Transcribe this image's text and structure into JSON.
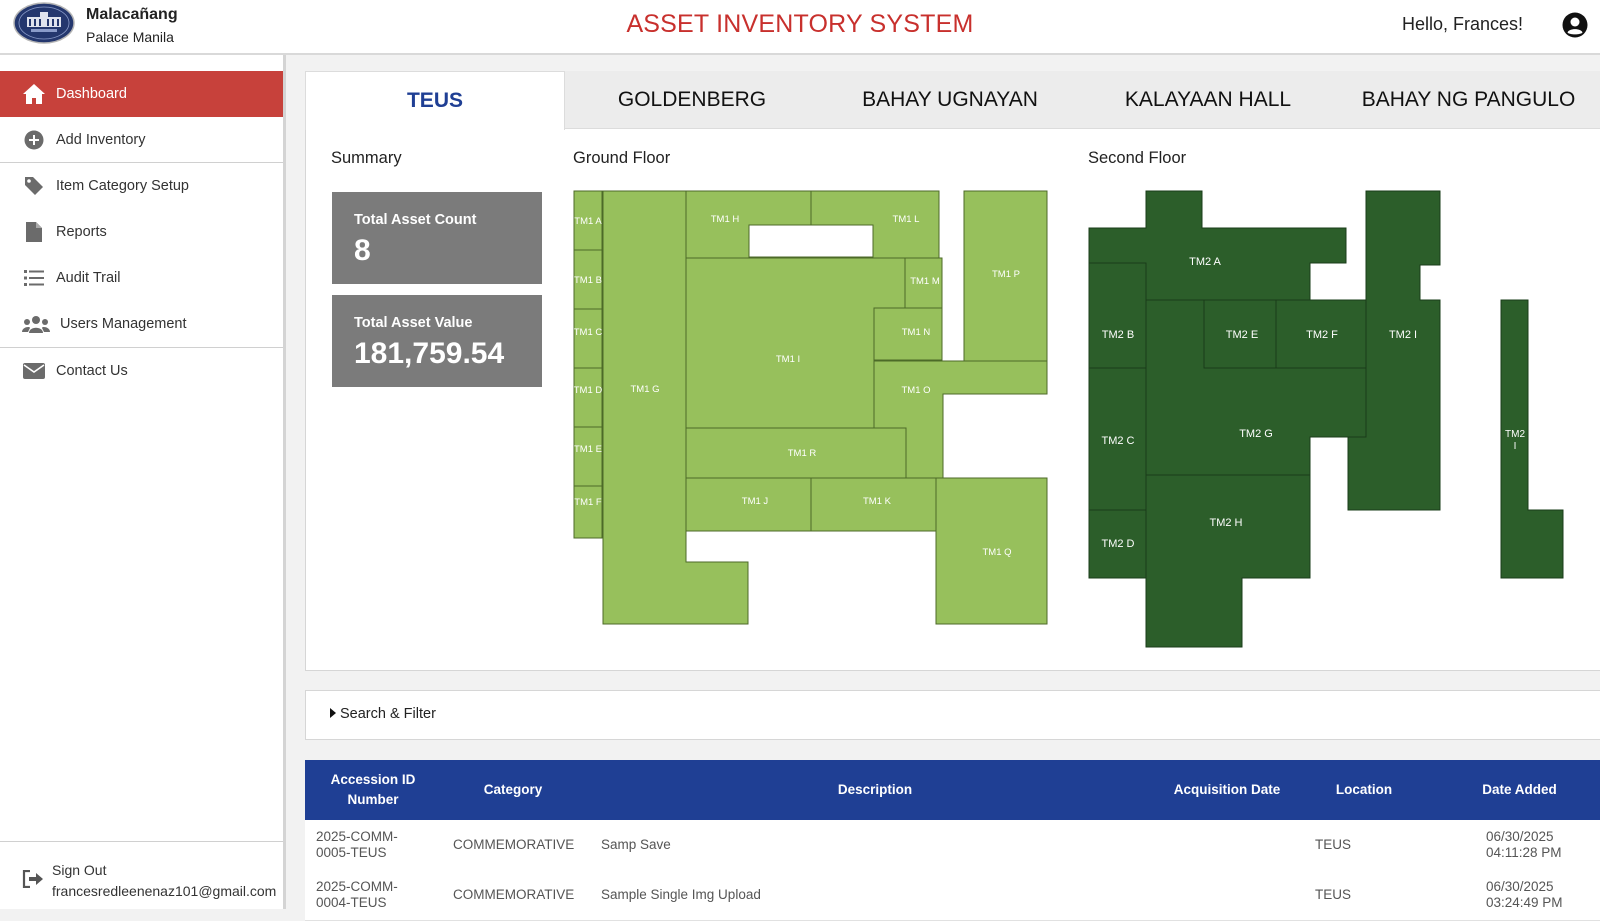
{
  "header": {
    "brand_line1": "Malacañang",
    "brand_line2": "Palace Manila",
    "app_title": "ASSET INVENTORY SYSTEM",
    "greeting": "Hello, Frances!"
  },
  "sidebar": {
    "items": [
      {
        "label": "Dashboard",
        "icon": "home-icon",
        "active": true
      },
      {
        "label": "Add Inventory",
        "icon": "plus-circle-icon"
      },
      {
        "label": "Item Category Setup",
        "icon": "tag-icon"
      },
      {
        "label": "Reports",
        "icon": "file-icon"
      },
      {
        "label": "Audit Trail",
        "icon": "list-icon"
      },
      {
        "label": "Users Management",
        "icon": "users-icon"
      },
      {
        "label": "Contact Us",
        "icon": "envelope-icon"
      }
    ],
    "signout_label": "Sign Out",
    "email": "francesredleenenaz101@gmail.com"
  },
  "tabs": [
    "TEUS",
    "GOLDENBERG",
    "BAHAY UGNAYAN",
    "KALAYAAN HALL",
    "BAHAY NG PANGULO"
  ],
  "summary": {
    "title": "Summary",
    "count_label": "Total Asset Count",
    "count_value": "8",
    "value_label": "Total Asset Value",
    "value_value": "181,759.54"
  },
  "floors": {
    "ground_title": "Ground Floor",
    "second_title": "Second Floor",
    "ground_color": "#97c05c",
    "second_color": "#2c5e2a",
    "ground_rooms": [
      "TM1 A",
      "TM1 B",
      "TM1 C",
      "TM1 D",
      "TM1 E",
      "TM1 F",
      "TM1 G",
      "TM1 H",
      "TM1 L",
      "TM1 P",
      "TM1 M",
      "TM1 I",
      "TM1 N",
      "TM1 O",
      "TM1 R",
      "TM1 J",
      "TM1 K",
      "TM1 Q"
    ],
    "second_rooms": [
      "TM2 A",
      "TM2 B",
      "TM2 E",
      "TM2 F",
      "TM2 I",
      "TM2 C",
      "TM2 G",
      "TM2 D",
      "TM2 H",
      "TM2 I"
    ]
  },
  "filter_label": "Search & Filter",
  "table": {
    "headers": [
      "Accession ID Number",
      "Category",
      "Description",
      "Acquisition Date",
      "Location",
      "Date Added"
    ],
    "rows": [
      {
        "id_line1": "2025-COMM-",
        "id_line2": "0005-TEUS",
        "category": "COMMEMORATIVE",
        "description": "Samp Save",
        "acq_date": "",
        "location": "TEUS",
        "added_line1": "06/30/2025",
        "added_line2": "04:11:28 PM"
      },
      {
        "id_line1": "2025-COMM-",
        "id_line2": "0004-TEUS",
        "category": "COMMEMORATIVE",
        "description": "Sample Single Img Upload",
        "acq_date": "",
        "location": "TEUS",
        "added_line1": "06/30/2025",
        "added_line2": "03:24:49 PM"
      }
    ]
  },
  "colors": {
    "accent_red": "#c7413b",
    "title_red": "#c8302d",
    "table_blue": "#1f3f94",
    "stat_gray": "#7b7b7b"
  }
}
